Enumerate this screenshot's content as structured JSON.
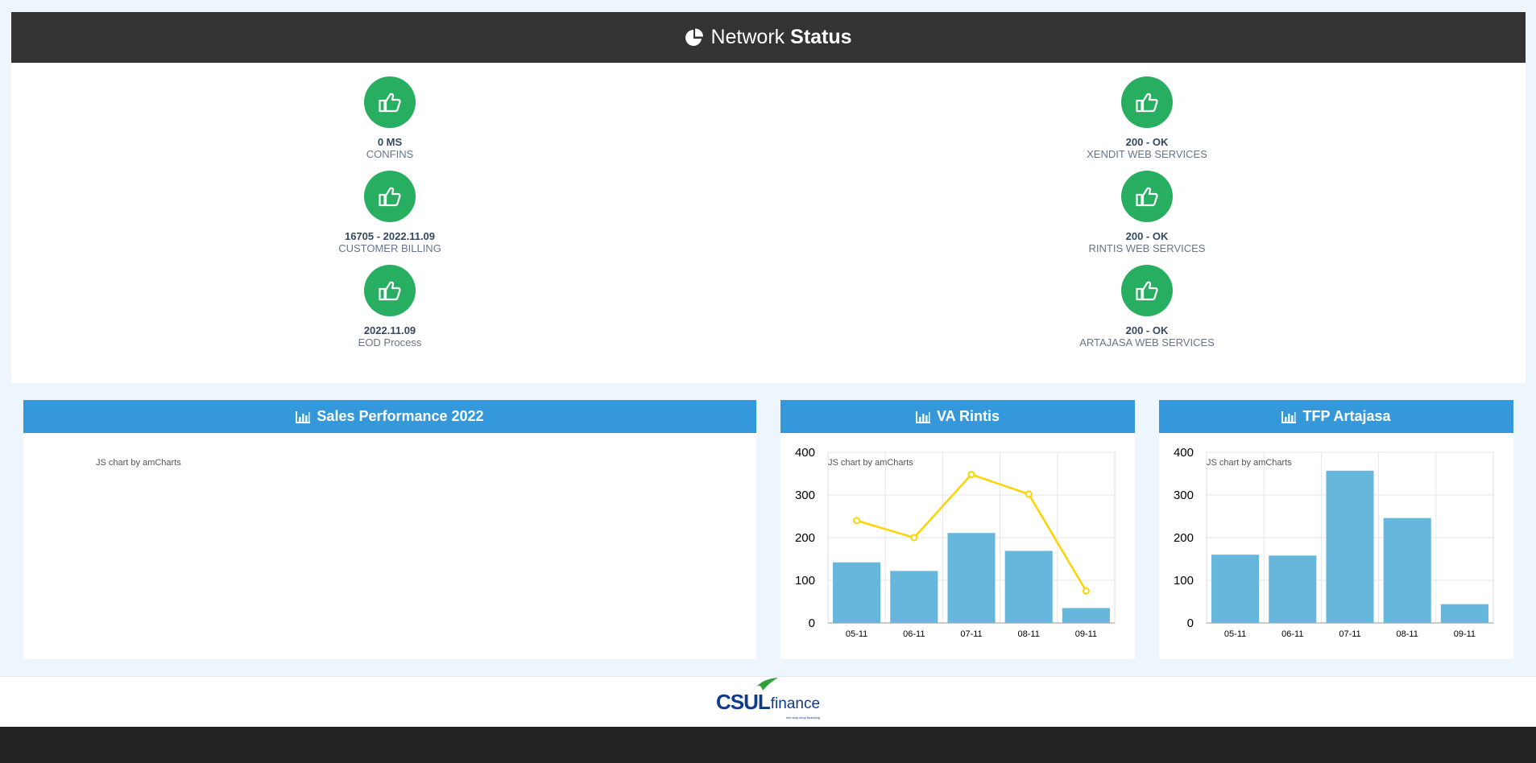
{
  "status": {
    "title_light": "Network",
    "title_bold": "Status",
    "left": [
      {
        "value": "0 MS",
        "name": "CONFINS"
      },
      {
        "value": "16705 - 2022.11.09",
        "name": "CUSTOMER BILLING"
      },
      {
        "value": "2022.11.09",
        "name": "EOD Process"
      }
    ],
    "right": [
      {
        "value": "200 - OK",
        "name": "XENDIT WEB SERVICES"
      },
      {
        "value": "200 - OK",
        "name": "RINTIS WEB SERVICES"
      },
      {
        "value": "200 - OK",
        "name": "ARTAJASA WEB SERVICES"
      }
    ],
    "ok_color": "#27ae60"
  },
  "cards": {
    "sales": {
      "title": "Sales Performance 2022",
      "credit": "JS chart by amCharts"
    },
    "rintis": {
      "title": "VA Rintis",
      "credit": "JS chart by amCharts"
    },
    "artajasa": {
      "title": "TFP Artajasa",
      "credit": "JS chart by amCharts"
    }
  },
  "chart_data": [
    {
      "type": "bar",
      "title": "VA Rintis",
      "categories": [
        "05-11",
        "06-11",
        "07-11",
        "08-11",
        "09-11"
      ],
      "series": [
        {
          "type": "bar",
          "values": [
            142,
            122,
            211,
            169,
            35
          ]
        },
        {
          "type": "line",
          "values": [
            240,
            200,
            348,
            302,
            75
          ]
        }
      ],
      "ylim": [
        0,
        400
      ],
      "yticks": [
        0,
        100,
        200,
        300,
        400
      ],
      "grid": true,
      "bar_color": "#67b7dc",
      "line_color": "#fdd400"
    },
    {
      "type": "bar",
      "title": "TFP Artajasa",
      "categories": [
        "05-11",
        "06-11",
        "07-11",
        "08-11",
        "09-11"
      ],
      "series": [
        {
          "type": "bar",
          "values": [
            160,
            158,
            357,
            246,
            44
          ]
        }
      ],
      "ylim": [
        0,
        400
      ],
      "yticks": [
        0,
        100,
        200,
        300,
        400
      ],
      "grid": true,
      "bar_color": "#67b7dc"
    }
  ],
  "footer": {
    "logo_main": "CSUL",
    "logo_sub": "finance",
    "logo_tag": "one stop shop financing"
  }
}
